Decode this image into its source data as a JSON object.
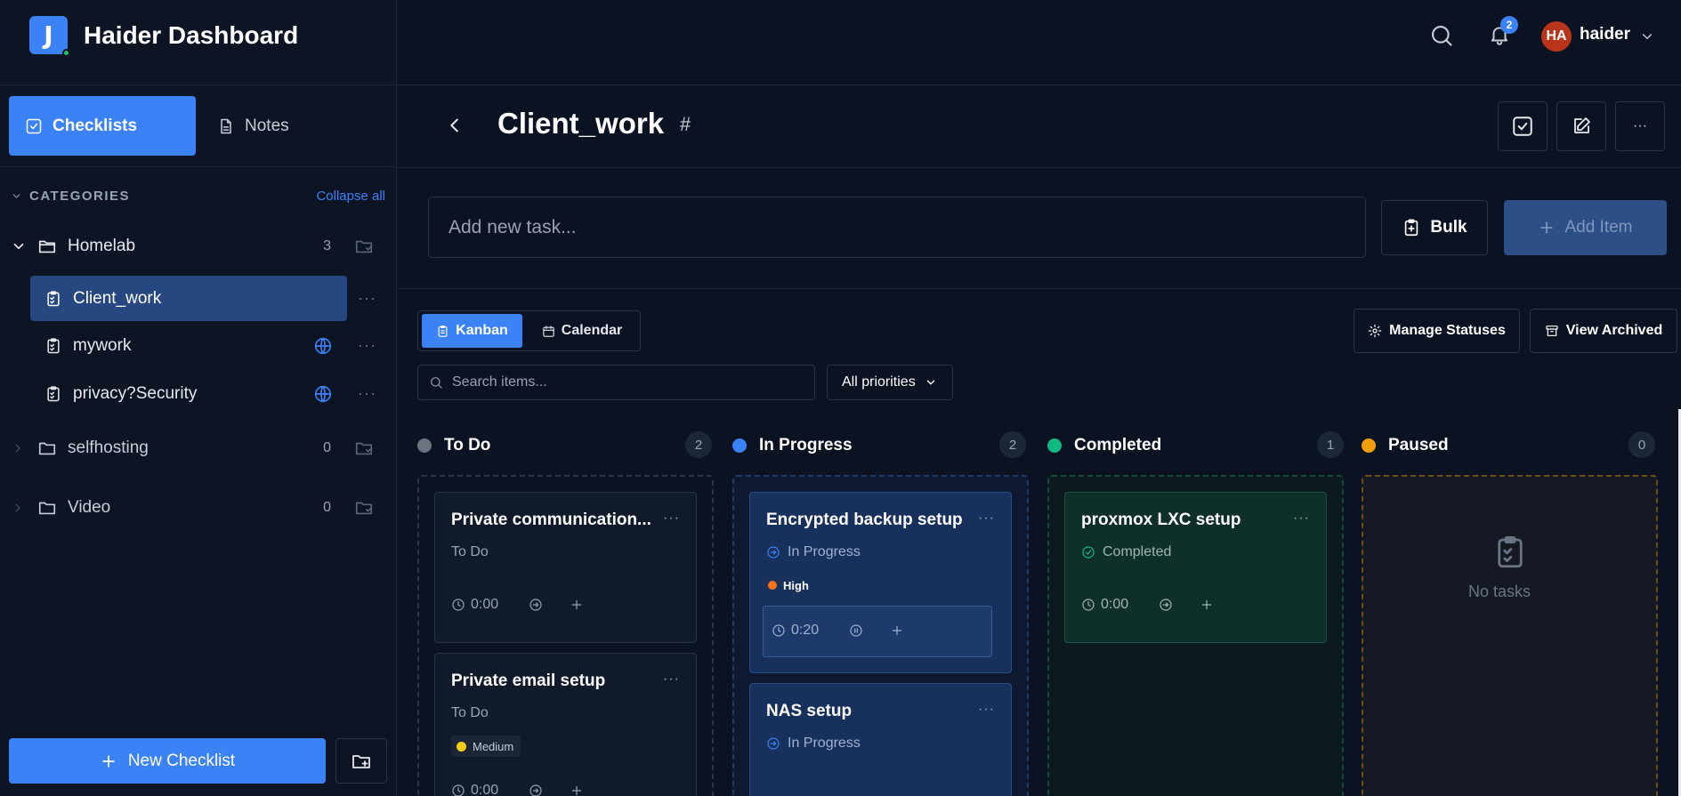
{
  "brand": {
    "logo_letter": "J",
    "title": "Haider Dashboard"
  },
  "mode_tabs": {
    "checklists": "Checklists",
    "notes": "Notes"
  },
  "categories": {
    "header": "CATEGORIES",
    "collapse_all": "Collapse all"
  },
  "folders": [
    {
      "name": "Homelab",
      "count": "3",
      "expanded": true
    },
    {
      "name": "selfhosting",
      "count": "0",
      "expanded": false
    },
    {
      "name": "Video",
      "count": "0",
      "expanded": false
    }
  ],
  "checklists": [
    {
      "label": "Client_work",
      "active": true,
      "shared": false
    },
    {
      "label": "mywork",
      "active": false,
      "shared": true
    },
    {
      "label": "privacy?Security",
      "active": false,
      "shared": true
    }
  ],
  "sidebar_footer": {
    "new_checklist": "New Checklist"
  },
  "topbar": {
    "notification_count": "2",
    "avatar_initials": "HA",
    "username": "haider"
  },
  "page": {
    "title": "Client_work",
    "hash": "#"
  },
  "add_task": {
    "placeholder": "Add new task...",
    "bulk_label": "Bulk",
    "add_label": "Add Item"
  },
  "views": {
    "kanban": "Kanban",
    "calendar": "Calendar",
    "manage_statuses": "Manage Statuses",
    "view_archived": "View Archived"
  },
  "filters": {
    "search_placeholder": "Search items...",
    "priority": "All priorities"
  },
  "kanban": {
    "columns": [
      {
        "name": "To Do",
        "count": "2",
        "color": "#6b7280"
      },
      {
        "name": "In Progress",
        "count": "2",
        "color": "#3b82f6"
      },
      {
        "name": "Completed",
        "count": "1",
        "color": "#10b981"
      },
      {
        "name": "Paused",
        "count": "0",
        "color": "#f59e0b"
      }
    ],
    "cards": {
      "todo_1": {
        "title": "Private communication...",
        "status": "To Do",
        "time": "0:00"
      },
      "todo_2": {
        "title": "Private email setup",
        "status": "To Do",
        "priority": "Medium",
        "time": "0:00"
      },
      "prog_1": {
        "title": "Encrypted backup setup",
        "status": "In Progress",
        "priority": "High",
        "time": "0:20"
      },
      "prog_2": {
        "title": "NAS setup",
        "status": "In Progress"
      },
      "done_1": {
        "title": "proxmox LXC setup",
        "status": "Completed",
        "time": "0:00"
      }
    },
    "empty_text": "No tasks"
  },
  "colors": {
    "accent": "#3b82f6",
    "priority_high": "#f97316",
    "priority_medium": "#facc15",
    "avatar": "#b8341b"
  }
}
